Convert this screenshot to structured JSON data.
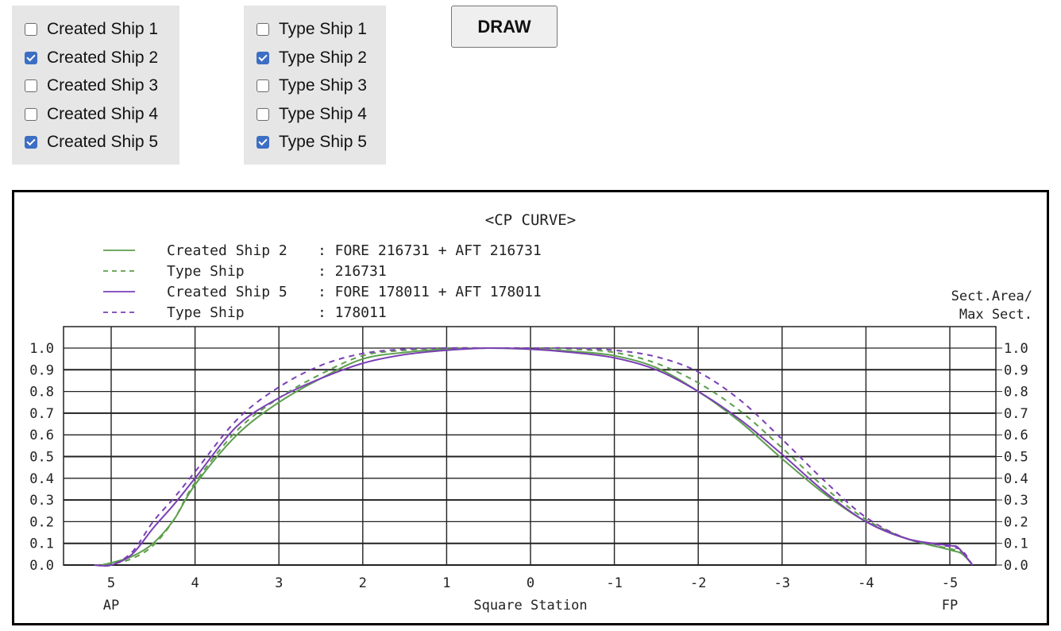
{
  "created_ships": [
    {
      "label": "Created Ship 1",
      "checked": false
    },
    {
      "label": "Created Ship 2",
      "checked": true
    },
    {
      "label": "Created Ship 3",
      "checked": false
    },
    {
      "label": "Created Ship 4",
      "checked": false
    },
    {
      "label": "Created Ship 5",
      "checked": true
    }
  ],
  "type_ships": [
    {
      "label": "Type Ship 1",
      "checked": false
    },
    {
      "label": "Type Ship 2",
      "checked": true
    },
    {
      "label": "Type Ship 3",
      "checked": false
    },
    {
      "label": "Type Ship 4",
      "checked": false
    },
    {
      "label": "Type Ship 5",
      "checked": true
    }
  ],
  "toolbar": {
    "draw_label": "DRAW"
  },
  "colors": {
    "green": "#5c9e4c",
    "purple": "#7b40b4",
    "checkbox_checked": "#3c6fc4"
  },
  "chart_data": {
    "type": "line",
    "title": "<CP CURVE>",
    "xlabel": "Square Station",
    "ylabel": "Sect.Area/ Max Sect.",
    "ylabel_lines": [
      "Sect.Area/",
      "Max Sect."
    ],
    "xlim": [
      5.6,
      -5.45
    ],
    "ylim": [
      0.0,
      1.1
    ],
    "x_ticks": [
      5,
      4,
      3,
      2,
      1,
      0,
      -1,
      -2,
      -3,
      -4,
      -5
    ],
    "x_tick_labels": [
      "5",
      "4",
      "3",
      "2",
      "1",
      "0",
      "-1",
      "-2",
      "-3",
      "-4",
      "-5"
    ],
    "x_end_labels": {
      "left": "AP",
      "right": "FP"
    },
    "y_ticks": [
      0.0,
      0.1,
      0.2,
      0.3,
      0.4,
      0.5,
      0.6,
      0.7,
      0.8,
      0.9,
      1.0
    ],
    "y_tick_labels": [
      "0.0",
      "0.1",
      "0.2",
      "0.3",
      "0.4",
      "0.5",
      "0.6",
      "0.7",
      "0.8",
      "0.9",
      "1.0"
    ],
    "grid": true,
    "legend_position": "top-left",
    "series": [
      {
        "name": "Created Ship 2",
        "legend_name": "Created Ship 2",
        "legend_value": ": FORE 216731 + AFT 216731",
        "color": "#5c9e4c",
        "style": "solid",
        "x": [
          5.12,
          5.0,
          4.75,
          4.5,
          4.25,
          4.0,
          3.5,
          3.0,
          2.5,
          2.0,
          1.5,
          1.0,
          0.5,
          0.0,
          -0.5,
          -1.0,
          -1.5,
          -2.0,
          -2.5,
          -3.0,
          -3.5,
          -4.0,
          -4.5,
          -5.0,
          -5.15,
          -5.27
        ],
        "y": [
          0.0,
          0.01,
          0.04,
          0.1,
          0.21,
          0.37,
          0.6,
          0.75,
          0.86,
          0.95,
          0.98,
          0.995,
          1.0,
          0.995,
          0.985,
          0.965,
          0.91,
          0.8,
          0.66,
          0.49,
          0.33,
          0.2,
          0.12,
          0.07,
          0.05,
          0.0
        ]
      },
      {
        "name": "Type Ship 216731",
        "legend_name": "Type Ship",
        "legend_value": ": 216731",
        "color": "#5c9e4c",
        "style": "dashed",
        "x": [
          5.2,
          5.0,
          4.75,
          4.5,
          4.25,
          4.0,
          3.5,
          3.0,
          2.5,
          2.0,
          1.5,
          1.0,
          0.5,
          0.0,
          -0.5,
          -1.0,
          -1.5,
          -2.0,
          -2.5,
          -3.0,
          -3.5,
          -4.0,
          -4.5,
          -5.0,
          -5.15,
          -5.27
        ],
        "y": [
          0.0,
          0.005,
          0.03,
          0.09,
          0.21,
          0.38,
          0.62,
          0.77,
          0.88,
          0.965,
          0.99,
          1.0,
          1.0,
          1.0,
          0.995,
          0.98,
          0.93,
          0.84,
          0.71,
          0.54,
          0.36,
          0.21,
          0.12,
          0.075,
          0.055,
          0.0
        ]
      },
      {
        "name": "Created Ship 5",
        "legend_name": "Created Ship 5",
        "legend_value": ": FORE 178011 + AFT 178011",
        "color": "#7b40b4",
        "style": "solid",
        "x": [
          5.2,
          5.0,
          4.75,
          4.5,
          4.25,
          4.0,
          3.5,
          3.0,
          2.5,
          2.0,
          1.5,
          1.0,
          0.5,
          0.0,
          -0.5,
          -1.0,
          -1.5,
          -2.0,
          -2.5,
          -3.0,
          -3.5,
          -4.0,
          -4.5,
          -5.0,
          -5.1,
          -5.27
        ],
        "y": [
          0.0,
          0.0,
          0.05,
          0.17,
          0.28,
          0.4,
          0.64,
          0.77,
          0.86,
          0.93,
          0.97,
          0.99,
          1.0,
          0.995,
          0.98,
          0.955,
          0.9,
          0.8,
          0.67,
          0.51,
          0.34,
          0.2,
          0.12,
          0.09,
          0.08,
          0.0
        ]
      },
      {
        "name": "Type Ship 178011",
        "legend_name": "Type Ship",
        "legend_value": ": 178011",
        "color": "#7b40b4",
        "style": "dashed",
        "x": [
          5.2,
          5.0,
          4.75,
          4.5,
          4.25,
          4.0,
          3.5,
          3.0,
          2.5,
          2.0,
          1.5,
          1.0,
          0.5,
          0.0,
          -0.5,
          -1.0,
          -1.5,
          -2.0,
          -2.5,
          -3.0,
          -3.5,
          -4.0,
          -4.5,
          -5.0,
          -5.15,
          -5.27
        ],
        "y": [
          0.0,
          0.0,
          0.06,
          0.2,
          0.31,
          0.43,
          0.67,
          0.82,
          0.92,
          0.975,
          0.995,
          1.0,
          1.0,
          1.0,
          1.0,
          0.99,
          0.96,
          0.89,
          0.76,
          0.58,
          0.39,
          0.22,
          0.12,
          0.085,
          0.065,
          0.0
        ]
      }
    ]
  }
}
